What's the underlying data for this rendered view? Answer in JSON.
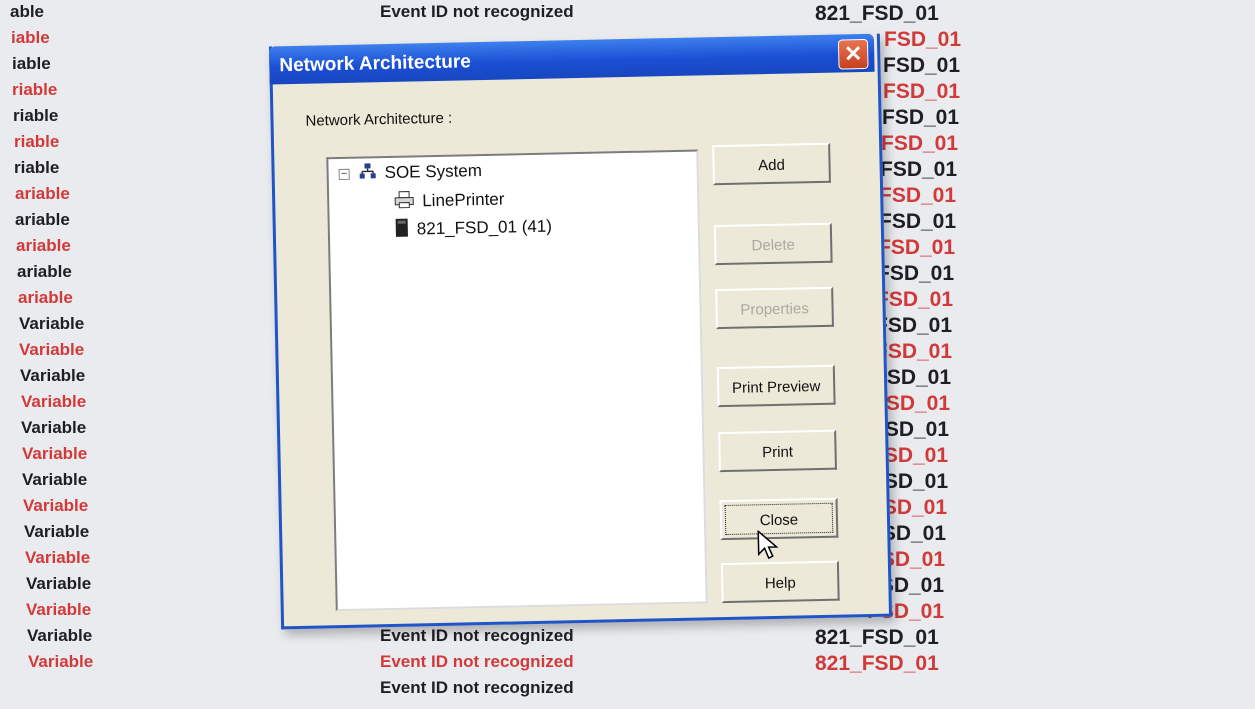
{
  "background_log": {
    "rows": [
      {
        "variable": "able",
        "event": "Event ID not recognized",
        "source": "821_FSD_01",
        "color": "black"
      },
      {
        "variable": "iable",
        "event": "",
        "source": "FSD_01",
        "color": "red"
      },
      {
        "variable": "iable",
        "event": "",
        "source": "FSD_01",
        "color": "black"
      },
      {
        "variable": "riable",
        "event": "",
        "source": "FSD_01",
        "color": "red"
      },
      {
        "variable": "riable",
        "event": "",
        "source": "FSD_01",
        "color": "black"
      },
      {
        "variable": "riable",
        "event": "",
        "source": "FSD_01",
        "color": "red"
      },
      {
        "variable": "riable",
        "event": "",
        "source": "FSD_01",
        "color": "black"
      },
      {
        "variable": "ariable",
        "event": "",
        "source": "FSD_01",
        "color": "red"
      },
      {
        "variable": "ariable",
        "event": "",
        "source": "FSD_01",
        "color": "black"
      },
      {
        "variable": "ariable",
        "event": "",
        "source": "FSD_01",
        "color": "red"
      },
      {
        "variable": "ariable",
        "event": "",
        "source": "FSD_01",
        "color": "black"
      },
      {
        "variable": "ariable",
        "event": "",
        "source": "FSD_01",
        "color": "red"
      },
      {
        "variable": "Variable",
        "event": "",
        "source": "FSD_01",
        "color": "black"
      },
      {
        "variable": "Variable",
        "event": "",
        "source": "FSD_01",
        "color": "red"
      },
      {
        "variable": "Variable",
        "event": "",
        "source": "FSD_01",
        "color": "black"
      },
      {
        "variable": "Variable",
        "event": "",
        "source": "FSD_01",
        "color": "red"
      },
      {
        "variable": "Variable",
        "event": "",
        "source": "FSD_01",
        "color": "black"
      },
      {
        "variable": "Variable",
        "event": "",
        "source": "FSD_01",
        "color": "red"
      },
      {
        "variable": "Variable",
        "event": "",
        "source": "FSD_01",
        "color": "black"
      },
      {
        "variable": "Variable",
        "event": "",
        "source": "FSD_01",
        "color": "red"
      },
      {
        "variable": "Variable",
        "event": "",
        "source": "FSD_01",
        "color": "black"
      },
      {
        "variable": "Variable",
        "event": "",
        "source": "FSD_01",
        "color": "red"
      },
      {
        "variable": "Variable",
        "event": "",
        "source": "FSD_01",
        "color": "black"
      },
      {
        "variable": "Variable",
        "event": "Event ID not recognized",
        "source": "FSD_01",
        "color": "red"
      },
      {
        "variable": "Variable",
        "event": "Event ID not recognized",
        "source": "821_FSD_01",
        "color": "black"
      },
      {
        "variable": "Variable",
        "event": "Event ID not recognized",
        "source": "821_FSD_01",
        "color": "red"
      },
      {
        "variable": "",
        "event": "Event ID not recognized",
        "source": "",
        "color": "black"
      }
    ]
  },
  "dialog": {
    "title": "Network Architecture",
    "close_glyph": "✕",
    "group_label": "Network Architecture :",
    "tree": {
      "expander": "−",
      "root": "SOE System",
      "children": [
        "LinePrinter",
        "821_FSD_01 (41)"
      ]
    },
    "buttons": {
      "add": "Add",
      "delete": "Delete",
      "properties": "Properties",
      "print_preview": "Print Preview",
      "print": "Print",
      "close": "Close",
      "help": "Help"
    }
  },
  "colors": {
    "title_bar": "#1b4fd4",
    "close_button": "#d4522c",
    "log_red": "#d23a3a",
    "log_black": "#1e1e24",
    "dialog_face": "#ece9d8"
  }
}
